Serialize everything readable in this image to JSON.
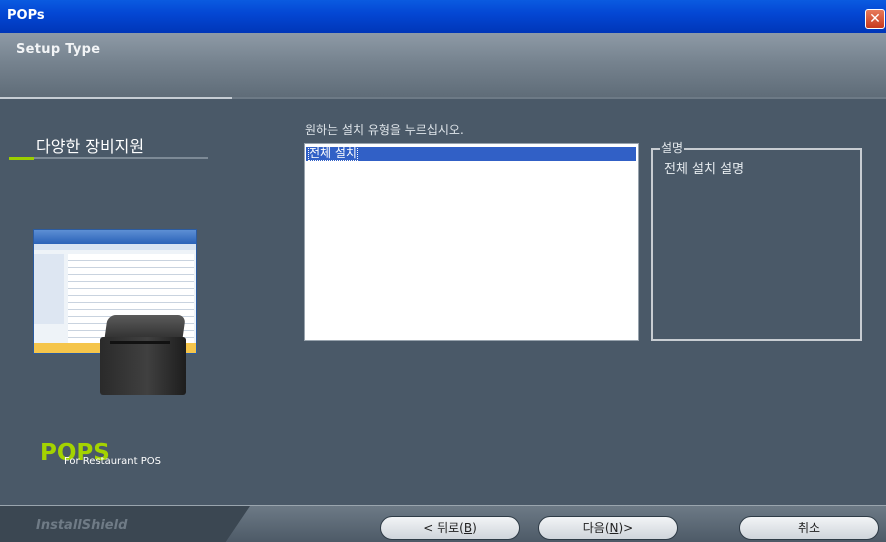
{
  "window": {
    "title": "POPs",
    "close_symbol": "✕"
  },
  "header": {
    "setup_type": "Setup Type"
  },
  "left_panel": {
    "title": "다양한 장비지원",
    "logo_text": "POPS",
    "logo_sub": "For Restaurant POS"
  },
  "content": {
    "prompt": "원하는 설치 유형을 누르십시오.",
    "setup_options": [
      "전체 설치"
    ],
    "selected_option": "전체 설치",
    "description_legend": "설명",
    "description_text": "전체 설치 설명"
  },
  "footer": {
    "brand": "InstallShield",
    "back_pre": "< 뒤로(",
    "back_key": "B",
    "back_post": ")",
    "next_pre": "다음(",
    "next_key": "N",
    "next_post": ")>",
    "cancel": "취소"
  },
  "colors": {
    "title_bar": "#0447d4",
    "panel": "#4a5968",
    "accent": "#9ccf00",
    "selection": "#3160c6"
  }
}
